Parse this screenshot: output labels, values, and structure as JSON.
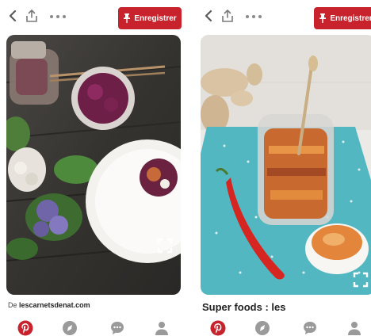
{
  "colors": {
    "brand_red": "#c8232c",
    "icon_gray": "#9a9a9a",
    "dark_icon": "#5b5b5b"
  },
  "left_pin": {
    "save_label": "Enregistrer",
    "source_prefix": "De",
    "source_domain": "lescarnetsdenat.com",
    "image_subject": "salad-flatlay-photo"
  },
  "right_pin": {
    "save_label": "Enregistrer",
    "title": "Super foods : les",
    "image_subject": "pickled-vegetables-jar-photo"
  },
  "bottom_nav": {
    "items": [
      "home-icon",
      "explore-icon",
      "messages-icon",
      "profile-icon"
    ]
  }
}
